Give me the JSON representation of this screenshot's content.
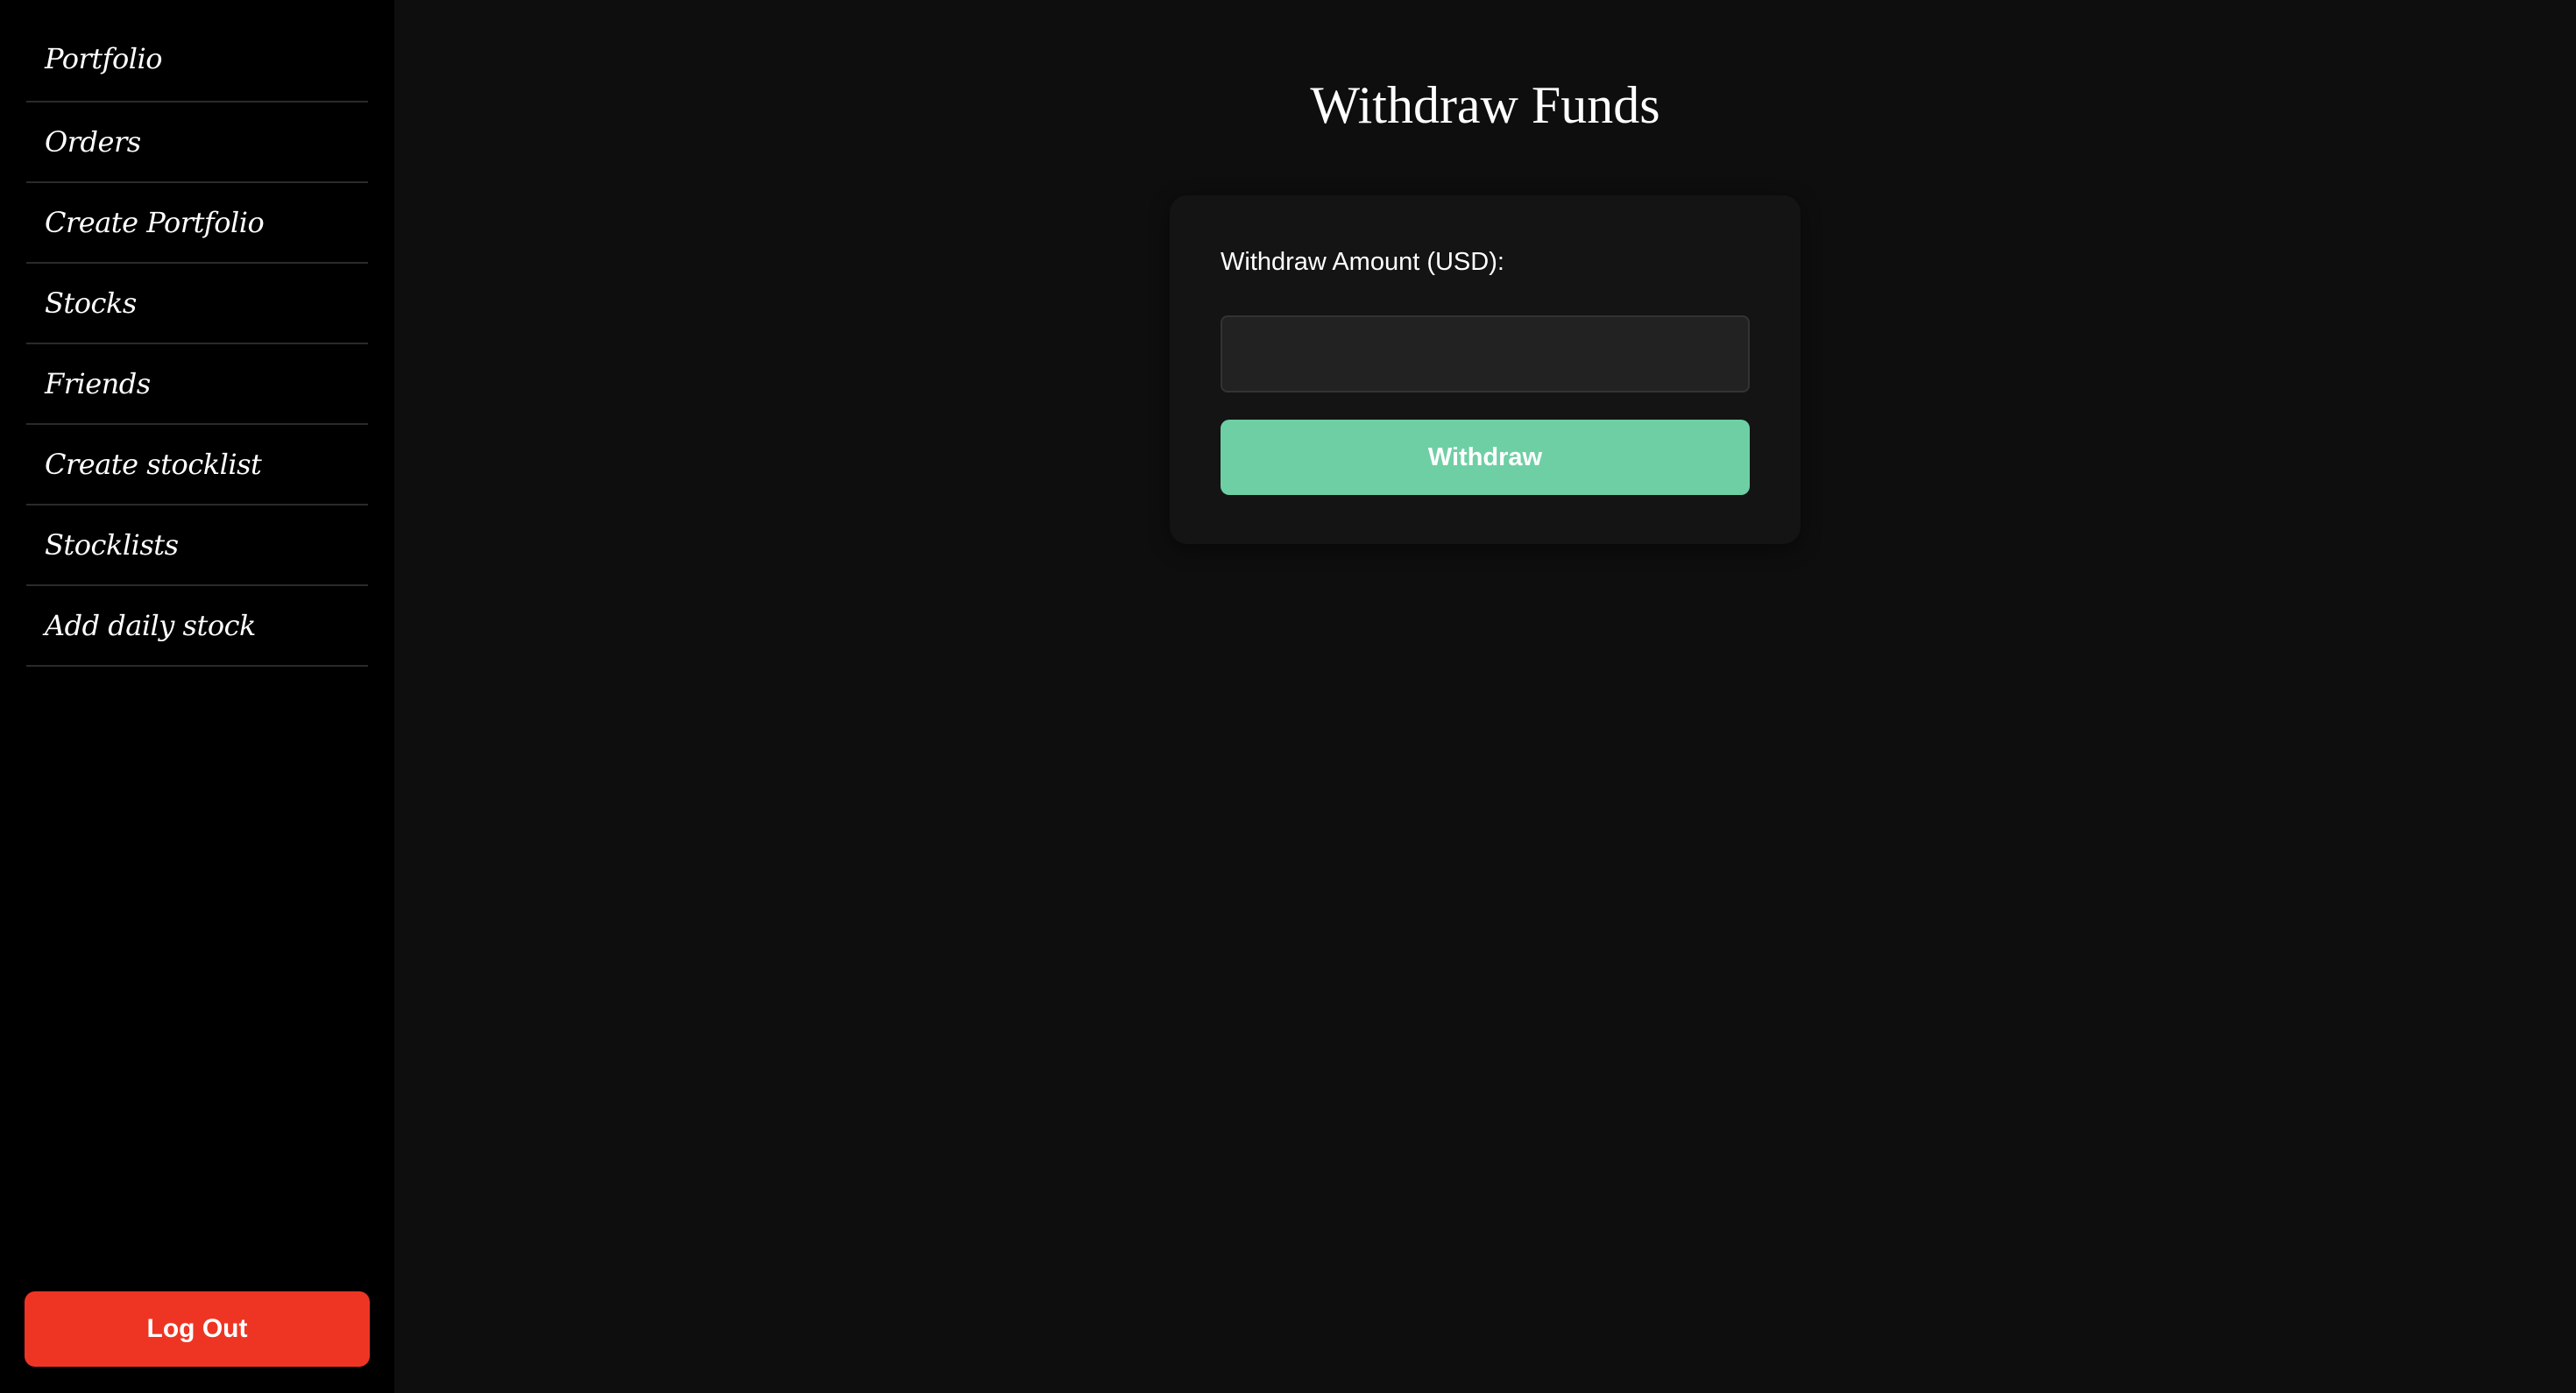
{
  "sidebar": {
    "items": [
      {
        "label": "Portfolio"
      },
      {
        "label": "Orders"
      },
      {
        "label": "Create Portfolio"
      },
      {
        "label": "Stocks"
      },
      {
        "label": "Friends"
      },
      {
        "label": "Create stocklist"
      },
      {
        "label": "Stocklists"
      },
      {
        "label": "Add daily stock"
      }
    ],
    "logout_label": "Log Out"
  },
  "main": {
    "title": "Withdraw Funds",
    "form": {
      "amount_label": "Withdraw Amount (USD):",
      "amount_value": "",
      "submit_label": "Withdraw"
    }
  },
  "colors": {
    "sidebar_bg": "#000000",
    "main_bg": "#0e0e0e",
    "card_bg": "#141414",
    "withdraw_button": "#6ecfa4",
    "logout_button": "#ee3524"
  }
}
